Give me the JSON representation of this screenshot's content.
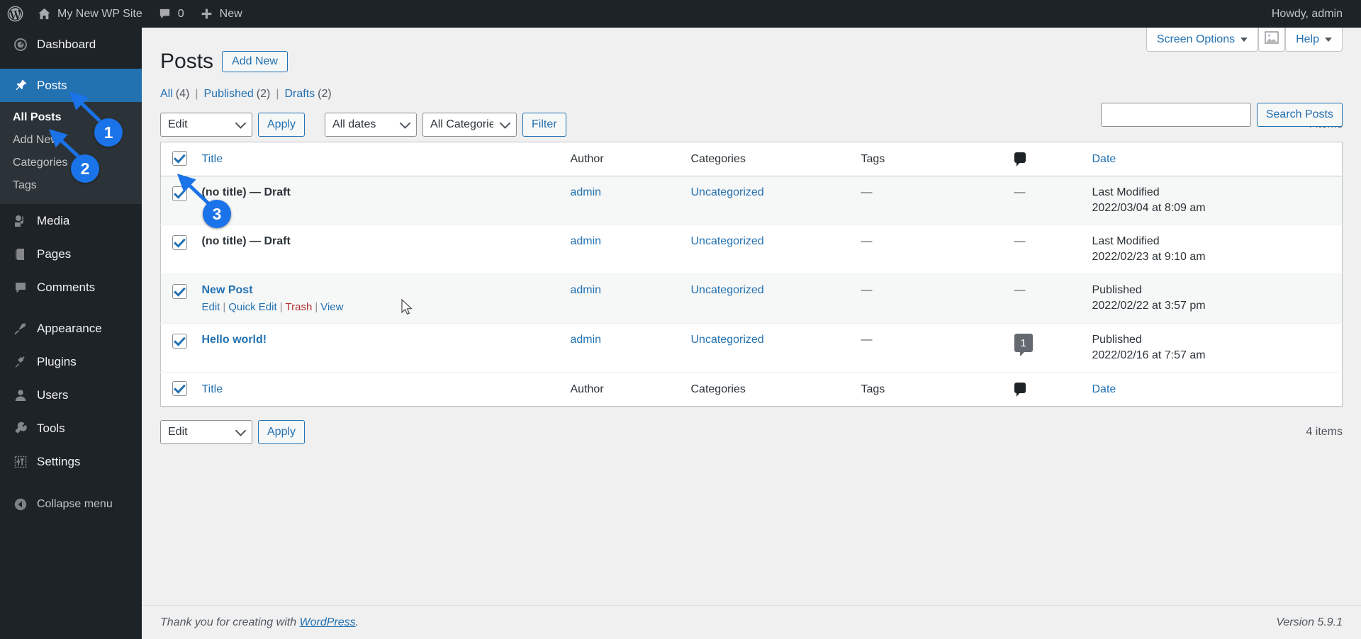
{
  "adminbar": {
    "wp_logo_icon": "wordpress-logo-icon",
    "site_icon": "home-icon",
    "site_name": "My New WP Site",
    "comments_icon": "comment-bubble-icon",
    "comments_count": "0",
    "new_icon": "plus-icon",
    "new_label": "New",
    "howdy": "Howdy, admin"
  },
  "sidebar": {
    "items": [
      {
        "label": "Dashboard",
        "icon": "dashboard-gauge-icon",
        "current": false
      },
      {
        "label": "Posts",
        "icon": "pushpin-icon",
        "current": true
      },
      {
        "label": "Media",
        "icon": "media-photo-note-icon",
        "current": false
      },
      {
        "label": "Pages",
        "icon": "page-document-icon",
        "current": false
      },
      {
        "label": "Comments",
        "icon": "comment-bubble-icon",
        "current": false
      },
      {
        "label": "Appearance",
        "icon": "paintbrush-icon",
        "current": false
      },
      {
        "label": "Plugins",
        "icon": "plug-icon",
        "current": false
      },
      {
        "label": "Users",
        "icon": "user-silhouette-icon",
        "current": false
      },
      {
        "label": "Tools",
        "icon": "wrench-icon",
        "current": false
      },
      {
        "label": "Settings",
        "icon": "settings-sliders-icon",
        "current": false
      }
    ],
    "posts_submenu": [
      {
        "label": "All Posts",
        "current": true
      },
      {
        "label": "Add New",
        "current": false
      },
      {
        "label": "Categories",
        "current": false
      },
      {
        "label": "Tags",
        "current": false
      }
    ],
    "collapse": {
      "label": "Collapse menu",
      "icon": "chevron-left-circle-icon"
    }
  },
  "screen_meta": {
    "screen_options_label": "Screen Options",
    "help_label": "Help",
    "media_icon": "image-placeholder-icon",
    "caret_icon": "caret-down-icon"
  },
  "page": {
    "title": "Posts",
    "add_new_label": "Add New"
  },
  "views": {
    "all": {
      "label": "All",
      "count": "(4)"
    },
    "published": {
      "label": "Published",
      "count": "(2)"
    },
    "drafts": {
      "label": "Drafts",
      "count": "(2)"
    },
    "separator": "|"
  },
  "toolbar_top": {
    "bulk_action_value": "Edit",
    "apply_label": "Apply",
    "dates_value": "All dates",
    "categories_value": "All Categories",
    "filter_label": "Filter",
    "items_count": "4 items"
  },
  "toolbar_bottom": {
    "bulk_action_value": "Edit",
    "apply_label": "Apply",
    "items_count": "4 items"
  },
  "search": {
    "value": "",
    "placeholder": "",
    "button_label": "Search Posts"
  },
  "table": {
    "select_all_checked": true,
    "columns": {
      "title": "Title",
      "author": "Author",
      "categories": "Categories",
      "tags": "Tags",
      "comments_icon": "comment-bubble-icon",
      "date": "Date"
    },
    "rows": [
      {
        "checked": true,
        "title": "(no title)",
        "title_is_link": false,
        "state": "— Draft",
        "author": "admin",
        "categories": "Uncategorized",
        "tags": "—",
        "comments": "—",
        "comment_is_bubble": false,
        "date_status": "Last Modified",
        "date_value": "2022/03/04 at 8:09 am",
        "show_actions": false,
        "alternate": true
      },
      {
        "checked": true,
        "title": "(no title)",
        "title_is_link": false,
        "state": "— Draft",
        "author": "admin",
        "categories": "Uncategorized",
        "tags": "—",
        "comments": "—",
        "comment_is_bubble": false,
        "date_status": "Last Modified",
        "date_value": "2022/02/23 at 9:10 am",
        "show_actions": false,
        "alternate": false
      },
      {
        "checked": true,
        "title": "New Post",
        "title_is_link": true,
        "state": "",
        "author": "admin",
        "categories": "Uncategorized",
        "tags": "—",
        "comments": "—",
        "comment_is_bubble": false,
        "date_status": "Published",
        "date_value": "2022/02/22 at 3:57 pm",
        "show_actions": true,
        "actions": [
          "Edit",
          "Quick Edit",
          "Trash",
          "View"
        ],
        "alternate": true
      },
      {
        "checked": true,
        "title": "Hello world!",
        "title_is_link": true,
        "state": "",
        "author": "admin",
        "categories": "Uncategorized",
        "tags": "—",
        "comments": "1",
        "comment_is_bubble": true,
        "date_status": "Published",
        "date_value": "2022/02/16 at 7:57 am",
        "show_actions": false,
        "alternate": false
      }
    ]
  },
  "footer": {
    "thanks_prefix": "Thank you for creating with ",
    "wordpress_link": "WordPress",
    "thanks_suffix": ".",
    "version": "Version 5.9.1"
  },
  "annotations": {
    "accent_color": "#1a73e8",
    "badges": [
      {
        "number": "1",
        "target": "posts-menu-item"
      },
      {
        "number": "2",
        "target": "all-posts-submenu-item"
      },
      {
        "number": "3",
        "target": "select-all-checkbox"
      }
    ]
  }
}
